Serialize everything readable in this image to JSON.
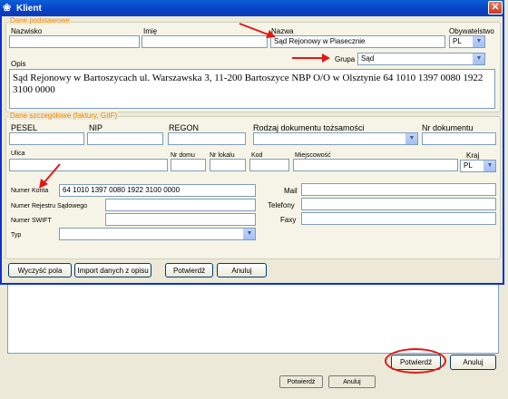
{
  "dialog": {
    "title": "Klient",
    "close_glyph": "✕",
    "icon": "app-icon"
  },
  "basic": {
    "group_title": "Dane podstawowe",
    "nazwisko_label": "Nazwisko",
    "nazwisko_value": "",
    "imie_label": "Imię",
    "imie_value": "",
    "nazwa_label": "Nazwa",
    "nazwa_value": "Sąd Rejonowy w Piasecznie",
    "obywatelstwo_label": "Obywatelstwo",
    "obywatelstwo_value": "PL",
    "grupa_label": "Grupa",
    "grupa_value": "Sąd",
    "opis_label": "Opis",
    "opis_value": "Sąd Rejonowy w Bartoszycach ul. Warszawska 3, 11-200 Bartoszyce NBP O/O w Olsztynie 64 1010 1397 0080 1922 3100 0000"
  },
  "details": {
    "group_title": "Dane szczegółowe (faktury, GIIF)",
    "pesel_label": "PESEL",
    "nip_label": "NIP",
    "regon_label": "REGON",
    "rodzaj_label": "Rodzaj dokumentu tożsamości",
    "nr_dokumentu_label": "Nr dokumentu",
    "ulica_label": "Ulica",
    "nr_domu_label": "Nr domu",
    "nr_lokalu_label": "Nr lokalu",
    "kod_label": "Kod",
    "miejscowosc_label": "Miejscowość",
    "kraj_label": "Kraj",
    "kraj_value": "PL",
    "numer_konta_label": "Numer Konta",
    "numer_konta_value": "64 1010 1397 0080 1922 3100 0000",
    "rejestr_label": "Numer Rejestru Sądowego",
    "swift_label": "Numer SWIFT",
    "typ_label": "Typ",
    "mail_label": "Mail",
    "telefony_label": "Telefony",
    "faxy_label": "Faxy"
  },
  "footer": {
    "clear_label": "Wyczyść pola",
    "import_label": "Import danych z opisu",
    "confirm_label": "Potwierdź",
    "cancel_label": "Anuluj"
  },
  "background": {
    "confirm_label": "Potwierdź",
    "cancel_label": "Anuluj",
    "under_confirm_label": "Potwierdź",
    "under_cancel_label": "Anuluj"
  },
  "colors": {
    "titlebar": "#0a5fd8",
    "group_title": "#f08a00",
    "annotation": "#e01818"
  }
}
